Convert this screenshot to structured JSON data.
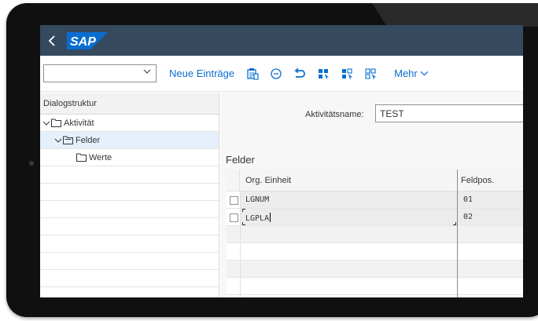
{
  "shell": {
    "back_icon": "chevron-left-icon",
    "logo_text": "SAP",
    "colors": {
      "shellbar": "#354a5f",
      "logo_blue": "#0a6ed1",
      "accent": "#0a6ed1"
    }
  },
  "toolbar": {
    "select_value": "",
    "new_entries_label": "Neue Einträge",
    "icons": [
      "copy-icon",
      "delete-icon",
      "undo-icon",
      "select-all-icon",
      "select-block-icon",
      "deselect-all-icon"
    ],
    "more_label": "Mehr"
  },
  "dialog_structure": {
    "header": "Dialogstruktur",
    "items": [
      {
        "label": "Aktivität",
        "level": 0,
        "expanded": true,
        "selected": false
      },
      {
        "label": "Felder",
        "level": 1,
        "expanded": true,
        "selected": true
      },
      {
        "label": "Werte",
        "level": 2,
        "expanded": false,
        "selected": false
      }
    ]
  },
  "detail": {
    "activity_label": "Aktivitätsname:",
    "activity_value": "TEST",
    "section_title": "Felder",
    "table": {
      "columns": [
        "Org. Einheit",
        "Feldpos."
      ],
      "rows": [
        {
          "org_unit": "LGNUM",
          "field_pos": "01",
          "checked": false
        },
        {
          "org_unit": "LGPLA",
          "field_pos": "02",
          "checked": false
        }
      ]
    }
  }
}
